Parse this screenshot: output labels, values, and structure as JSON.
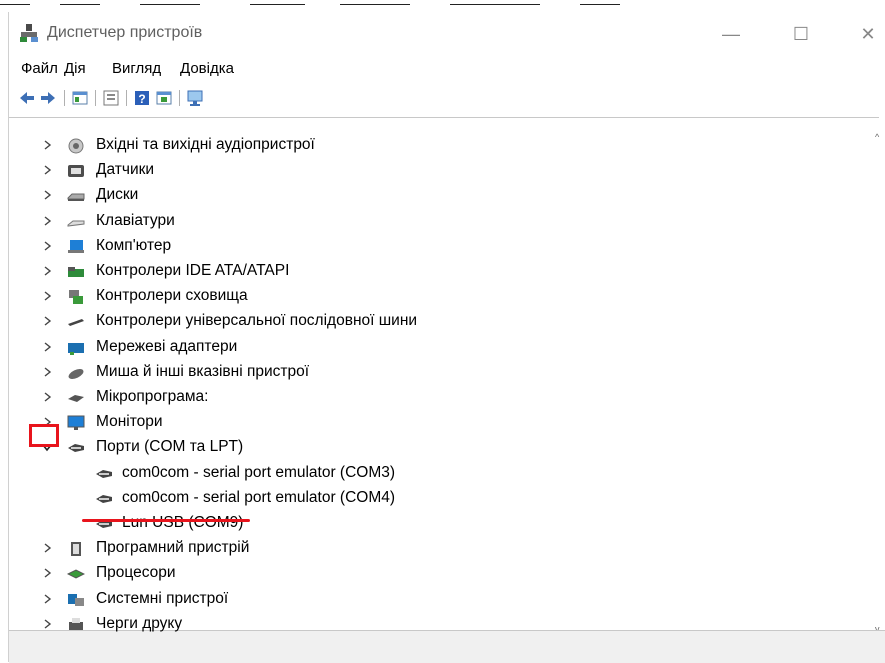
{
  "window": {
    "title": "Диспетчер пристроїв",
    "minimize_glyph": "—",
    "maximize_glyph": "☐",
    "close_glyph": "✕"
  },
  "menu": [
    "Файл",
    "Дія",
    "Вигляд",
    "Довідка"
  ],
  "toolbar": {
    "icons": [
      "back-icon",
      "forward-icon",
      "properties-icon",
      "update-driver-icon",
      "help-icon",
      "show-hidden-icon",
      "scan-icon"
    ]
  },
  "tree": {
    "items": [
      {
        "label": "Вхідні та вихідні аудіопристрої",
        "icon": "audio-icon",
        "expanded": false
      },
      {
        "label": "Датчики",
        "icon": "sensor-icon",
        "expanded": false
      },
      {
        "label": "Диски",
        "icon": "disk-icon",
        "expanded": false
      },
      {
        "label": "Клавіатури",
        "icon": "keyboard-icon",
        "expanded": false
      },
      {
        "label": "Комп'ютер",
        "icon": "computer-icon",
        "expanded": false
      },
      {
        "label": "Контролери IDE ATA/ATAPI",
        "icon": "ide-controller-icon",
        "expanded": false
      },
      {
        "label": "Контролери сховища",
        "icon": "storage-controller-icon",
        "expanded": false
      },
      {
        "label": "Контролери універсальної послідовної шини",
        "icon": "usb-icon",
        "expanded": false
      },
      {
        "label": "Мережеві адаптери",
        "icon": "network-adapter-icon",
        "expanded": false
      },
      {
        "label": "Миша й інші вказівні пристрої",
        "icon": "mouse-icon",
        "expanded": false
      },
      {
        "label": "Мікропрограма:",
        "icon": "firmware-icon",
        "expanded": false
      },
      {
        "label": "Монітори",
        "icon": "monitor-icon",
        "expanded": false
      },
      {
        "label": "Порти (COM та LPT)",
        "icon": "port-icon",
        "expanded": true,
        "children": [
          {
            "label": "com0com - serial port emulator (COM3)",
            "icon": "port-icon"
          },
          {
            "label": "com0com - serial port emulator (COM4)",
            "icon": "port-icon"
          },
          {
            "label": "Lun USB (COM9)",
            "icon": "port-icon"
          }
        ]
      },
      {
        "label": "Програмний пристрій",
        "icon": "software-device-icon",
        "expanded": false
      },
      {
        "label": "Процесори",
        "icon": "processor-icon",
        "expanded": false
      },
      {
        "label": "Системні пристрої",
        "icon": "system-device-icon",
        "expanded": false
      },
      {
        "label": "Черги друку",
        "icon": "printer-icon",
        "expanded": false
      }
    ]
  },
  "annotations": {
    "highlight_color": "#e8141c"
  }
}
